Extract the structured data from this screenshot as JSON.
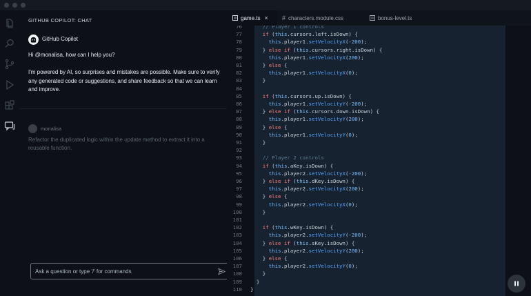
{
  "chat": {
    "header": "GITHUB COPILOT: CHAT",
    "assistant_name": "GitHub Copilot",
    "greeting": "Hi @monalisa, how can I help you?",
    "disclaimer": "I'm powered by AI, so surprises and mistakes are possible. Make sure to verify any generated code or suggestions, and share feedback so that we can learn and improve.",
    "user_name": "monalisa",
    "user_message": "Refactor the duplicated logic within the update method to extract it into a reusable function.",
    "input_placeholder": "Ask a question or type '/' for commands"
  },
  "tabs": [
    {
      "label": "game.ts",
      "active": true,
      "close": "×"
    },
    {
      "label": "characters.module.css",
      "active": false,
      "prefix": "#"
    },
    {
      "label": "bonus-level.ts",
      "active": false
    }
  ],
  "editor": {
    "lines": [
      {
        "n": "76",
        "tokens": [
          [
            "cm",
            "    // Player 1 controls"
          ]
        ]
      },
      {
        "n": "77",
        "tokens": [
          [
            "kw",
            "    if"
          ],
          [
            "pl",
            " ("
          ],
          [
            "th",
            "this"
          ],
          [
            "pl",
            ".cursors.left.isDown) {"
          ]
        ]
      },
      {
        "n": "78",
        "tokens": [
          [
            "th",
            "      this"
          ],
          [
            "pl",
            ".player1."
          ],
          [
            "fn",
            "setVelocityX"
          ],
          [
            "pl",
            "("
          ],
          [
            "nm",
            "-200"
          ],
          [
            "pl",
            ");"
          ]
        ]
      },
      {
        "n": "79",
        "tokens": [
          [
            "pl",
            "    } "
          ],
          [
            "kw",
            "else if"
          ],
          [
            "pl",
            " ("
          ],
          [
            "th",
            "this"
          ],
          [
            "pl",
            ".cursors.right.isDown) {"
          ]
        ]
      },
      {
        "n": "80",
        "tokens": [
          [
            "th",
            "      this"
          ],
          [
            "pl",
            ".player1."
          ],
          [
            "fn",
            "setVelocityX"
          ],
          [
            "pl",
            "("
          ],
          [
            "nm",
            "200"
          ],
          [
            "pl",
            ");"
          ]
        ]
      },
      {
        "n": "81",
        "tokens": [
          [
            "pl",
            "    } "
          ],
          [
            "kw",
            "else"
          ],
          [
            "pl",
            " {"
          ]
        ]
      },
      {
        "n": "82",
        "tokens": [
          [
            "th",
            "      this"
          ],
          [
            "pl",
            ".player1."
          ],
          [
            "fn",
            "setVelocityX"
          ],
          [
            "pl",
            "("
          ],
          [
            "nm",
            "0"
          ],
          [
            "pl",
            ");"
          ]
        ]
      },
      {
        "n": "83",
        "tokens": [
          [
            "pl",
            "    }"
          ]
        ]
      },
      {
        "n": "84",
        "tokens": []
      },
      {
        "n": "85",
        "tokens": [
          [
            "kw",
            "    if"
          ],
          [
            "pl",
            " ("
          ],
          [
            "th",
            "this"
          ],
          [
            "pl",
            ".cursors.up.isDown) {"
          ]
        ]
      },
      {
        "n": "86",
        "tokens": [
          [
            "th",
            "      this"
          ],
          [
            "pl",
            ".player1."
          ],
          [
            "fn",
            "setVelocityY"
          ],
          [
            "pl",
            "("
          ],
          [
            "nm",
            "-200"
          ],
          [
            "pl",
            ");"
          ]
        ]
      },
      {
        "n": "87",
        "tokens": [
          [
            "pl",
            "    } "
          ],
          [
            "kw",
            "else if"
          ],
          [
            "pl",
            " ("
          ],
          [
            "th",
            "this"
          ],
          [
            "pl",
            ".cursors.down.isDown) {"
          ]
        ]
      },
      {
        "n": "88",
        "tokens": [
          [
            "th",
            "      this"
          ],
          [
            "pl",
            ".player1."
          ],
          [
            "fn",
            "setVelocityY"
          ],
          [
            "pl",
            "("
          ],
          [
            "nm",
            "200"
          ],
          [
            "pl",
            ");"
          ]
        ]
      },
      {
        "n": "89",
        "tokens": [
          [
            "pl",
            "    } "
          ],
          [
            "kw",
            "else"
          ],
          [
            "pl",
            " {"
          ]
        ]
      },
      {
        "n": "90",
        "tokens": [
          [
            "th",
            "      this"
          ],
          [
            "pl",
            ".player1."
          ],
          [
            "fn",
            "setVelocityY"
          ],
          [
            "pl",
            "("
          ],
          [
            "nm",
            "0"
          ],
          [
            "pl",
            ");"
          ]
        ]
      },
      {
        "n": "91",
        "tokens": [
          [
            "pl",
            "    }"
          ]
        ]
      },
      {
        "n": "92",
        "tokens": []
      },
      {
        "n": "93",
        "tokens": [
          [
            "cm",
            "    // Player 2 controls"
          ]
        ]
      },
      {
        "n": "94",
        "tokens": [
          [
            "kw",
            "    if"
          ],
          [
            "pl",
            " ("
          ],
          [
            "th",
            "this"
          ],
          [
            "pl",
            ".aKey.isDown) {"
          ]
        ]
      },
      {
        "n": "95",
        "tokens": [
          [
            "th",
            "      this"
          ],
          [
            "pl",
            ".player2."
          ],
          [
            "fn",
            "setVelocityX"
          ],
          [
            "pl",
            "("
          ],
          [
            "nm",
            "-200"
          ],
          [
            "pl",
            ");"
          ]
        ]
      },
      {
        "n": "96",
        "tokens": [
          [
            "pl",
            "    } "
          ],
          [
            "kw",
            "else if"
          ],
          [
            "pl",
            " ("
          ],
          [
            "th",
            "this"
          ],
          [
            "pl",
            ".dKey.isDown) {"
          ]
        ]
      },
      {
        "n": "97",
        "tokens": [
          [
            "th",
            "      this"
          ],
          [
            "pl",
            ".player2."
          ],
          [
            "fn",
            "setVelocityX"
          ],
          [
            "pl",
            "("
          ],
          [
            "nm",
            "200"
          ],
          [
            "pl",
            ");"
          ]
        ]
      },
      {
        "n": "98",
        "tokens": [
          [
            "pl",
            "    } "
          ],
          [
            "kw",
            "else"
          ],
          [
            "pl",
            " {"
          ]
        ]
      },
      {
        "n": "99",
        "tokens": [
          [
            "th",
            "      this"
          ],
          [
            "pl",
            ".player2."
          ],
          [
            "fn",
            "setVelocityX"
          ],
          [
            "pl",
            "("
          ],
          [
            "nm",
            "0"
          ],
          [
            "pl",
            ");"
          ]
        ]
      },
      {
        "n": "100",
        "tokens": [
          [
            "pl",
            "    }"
          ]
        ]
      },
      {
        "n": "101",
        "tokens": []
      },
      {
        "n": "102",
        "tokens": [
          [
            "kw",
            "    if"
          ],
          [
            "pl",
            " ("
          ],
          [
            "th",
            "this"
          ],
          [
            "pl",
            ".wKey.isDown) {"
          ]
        ]
      },
      {
        "n": "103",
        "tokens": [
          [
            "th",
            "      this"
          ],
          [
            "pl",
            ".player2."
          ],
          [
            "fn",
            "setVelocityY"
          ],
          [
            "pl",
            "("
          ],
          [
            "nm",
            "-200"
          ],
          [
            "pl",
            ");"
          ]
        ]
      },
      {
        "n": "104",
        "tokens": [
          [
            "pl",
            "    } "
          ],
          [
            "kw",
            "else if"
          ],
          [
            "pl",
            " ("
          ],
          [
            "th",
            "this"
          ],
          [
            "pl",
            ".sKey.isDown) {"
          ]
        ]
      },
      {
        "n": "105",
        "tokens": [
          [
            "th",
            "      this"
          ],
          [
            "pl",
            ".player2."
          ],
          [
            "fn",
            "setVelocityY"
          ],
          [
            "pl",
            "("
          ],
          [
            "nm",
            "200"
          ],
          [
            "pl",
            ");"
          ]
        ]
      },
      {
        "n": "106",
        "tokens": [
          [
            "pl",
            "    } "
          ],
          [
            "kw",
            "else"
          ],
          [
            "pl",
            " {"
          ]
        ]
      },
      {
        "n": "107",
        "tokens": [
          [
            "th",
            "      this"
          ],
          [
            "pl",
            ".player2."
          ],
          [
            "fn",
            "setVelocityY"
          ],
          [
            "pl",
            "("
          ],
          [
            "nm",
            "0"
          ],
          [
            "pl",
            ");"
          ]
        ]
      },
      {
        "n": "108",
        "tokens": [
          [
            "pl",
            "    }"
          ]
        ]
      },
      {
        "n": "109",
        "tokens": [
          [
            "pl",
            "  }"
          ]
        ]
      },
      {
        "n": "110",
        "tokens": [
          [
            "pl",
            "}"
          ]
        ]
      }
    ]
  },
  "colors": {
    "background": "#0d1117",
    "selection": "#172230",
    "keyword": "#ff7b72",
    "function": "#58a6ff",
    "comment": "#5c7b91"
  },
  "icons": [
    "explorer-icon",
    "search-icon",
    "source-control-icon",
    "run-debug-icon",
    "extensions-icon",
    "chat-icon",
    "send-icon",
    "pause-icon"
  ]
}
